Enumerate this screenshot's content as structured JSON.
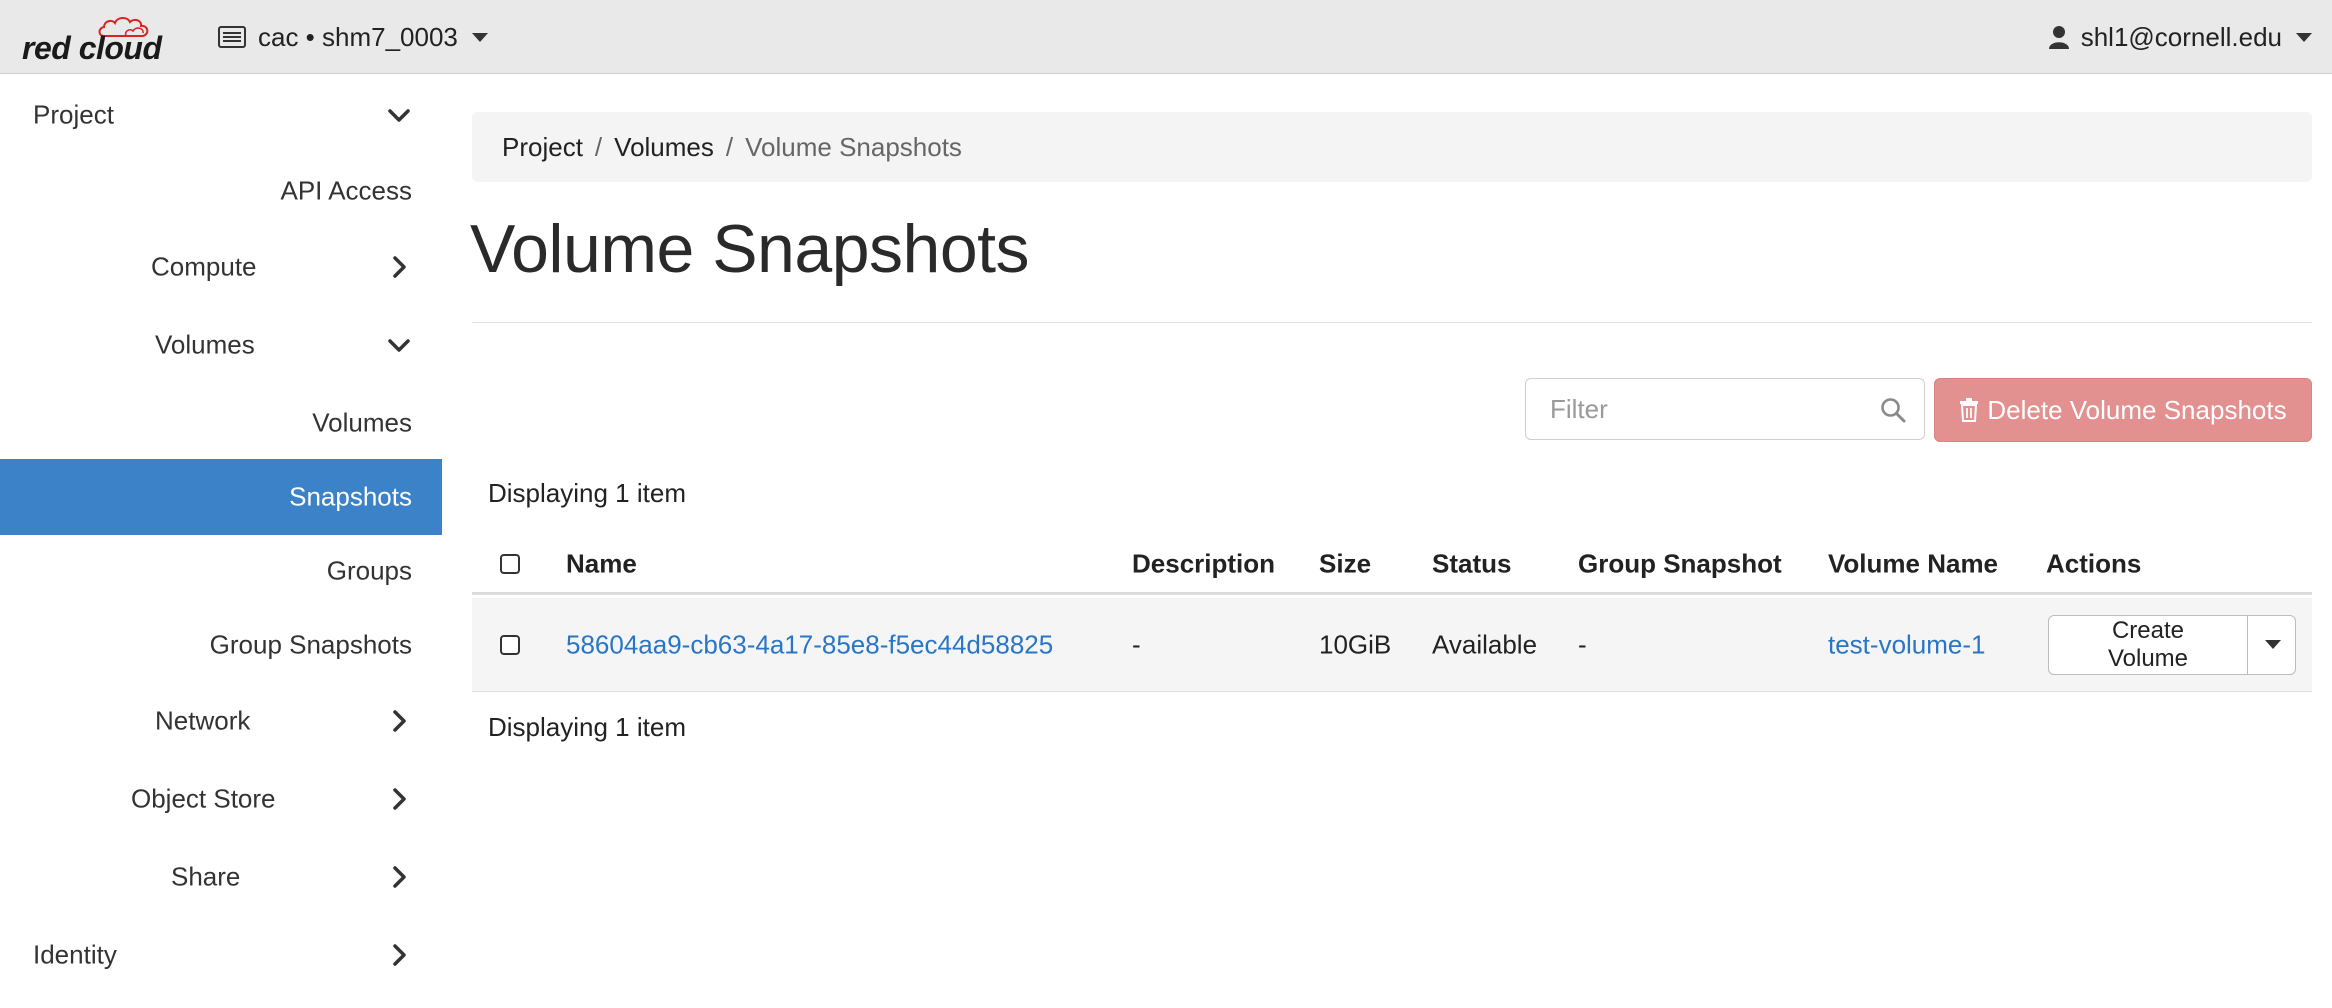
{
  "topbar": {
    "brand": "red cloud",
    "project_picker": "cac • shm7_0003",
    "user": "shl1@cornell.edu"
  },
  "sidebar": {
    "items": [
      {
        "label": "Project",
        "chevron": "down"
      },
      {
        "label": "API Access"
      },
      {
        "label": "Compute",
        "chevron": "right"
      },
      {
        "label": "Volumes",
        "chevron": "down"
      },
      {
        "label": "Volumes"
      },
      {
        "label": "Snapshots",
        "active": true
      },
      {
        "label": "Groups"
      },
      {
        "label": "Group Snapshots"
      },
      {
        "label": "Network",
        "chevron": "right"
      },
      {
        "label": "Object Store",
        "chevron": "right"
      },
      {
        "label": "Share",
        "chevron": "right"
      },
      {
        "label": "Identity",
        "chevron": "right"
      }
    ]
  },
  "breadcrumb": {
    "items": [
      "Project",
      "Volumes",
      "Volume Snapshots"
    ],
    "separator": "/"
  },
  "page": {
    "title": "Volume Snapshots"
  },
  "toolbar": {
    "filter_placeholder": "Filter",
    "delete_label": "Delete Volume Snapshots"
  },
  "table": {
    "count_top": "Displaying 1 item",
    "count_bottom": "Displaying 1 item",
    "headers": [
      "Name",
      "Description",
      "Size",
      "Status",
      "Group Snapshot",
      "Volume Name",
      "Actions"
    ],
    "rows": [
      {
        "name": "58604aa9-cb63-4a17-85e8-f5ec44d58825",
        "description": "-",
        "size": "10GiB",
        "status": "Available",
        "group_snapshot": "-",
        "volume_name": "test-volume-1",
        "action_label": "Create Volume"
      }
    ]
  },
  "colors": {
    "active_nav": "#3b82c9",
    "link": "#2a76c6",
    "danger_button": "#e39090",
    "topbar_bg": "#e9e9e9"
  },
  "icons": {
    "brand": "red-cloud-logo",
    "project": "server-icon",
    "user": "user-icon",
    "filter": "search-icon",
    "delete": "trash-icon"
  }
}
